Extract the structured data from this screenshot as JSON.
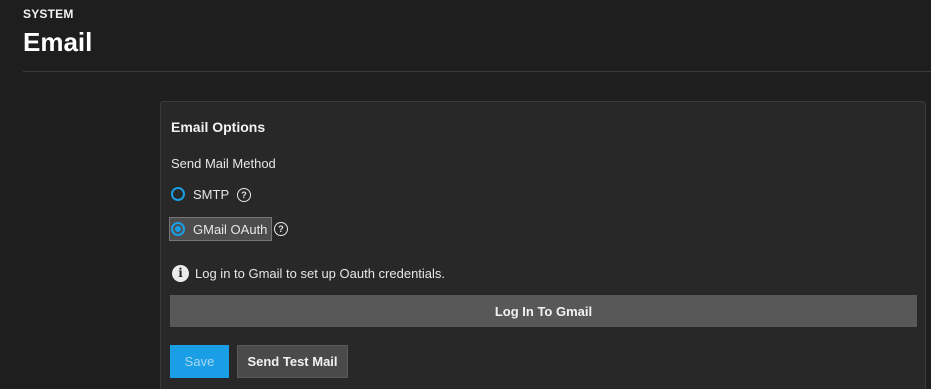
{
  "header": {
    "section": "SYSTEM",
    "title": "Email"
  },
  "card": {
    "title": "Email Options",
    "send_method_label": "Send Mail Method",
    "options": [
      {
        "label": "SMTP",
        "selected": false
      },
      {
        "label": "GMail OAuth",
        "selected": true
      }
    ],
    "info_text": "Log in to Gmail to set up Oauth credentials.",
    "login_button": "Log In To Gmail",
    "save_button": "Save",
    "test_button": "Send Test Mail"
  },
  "colors": {
    "accent": "#1a9ee6",
    "background": "#1e1e1e",
    "card": "#282828"
  },
  "icons": {
    "help": "question-circle-icon",
    "info": "info-circle-icon"
  }
}
